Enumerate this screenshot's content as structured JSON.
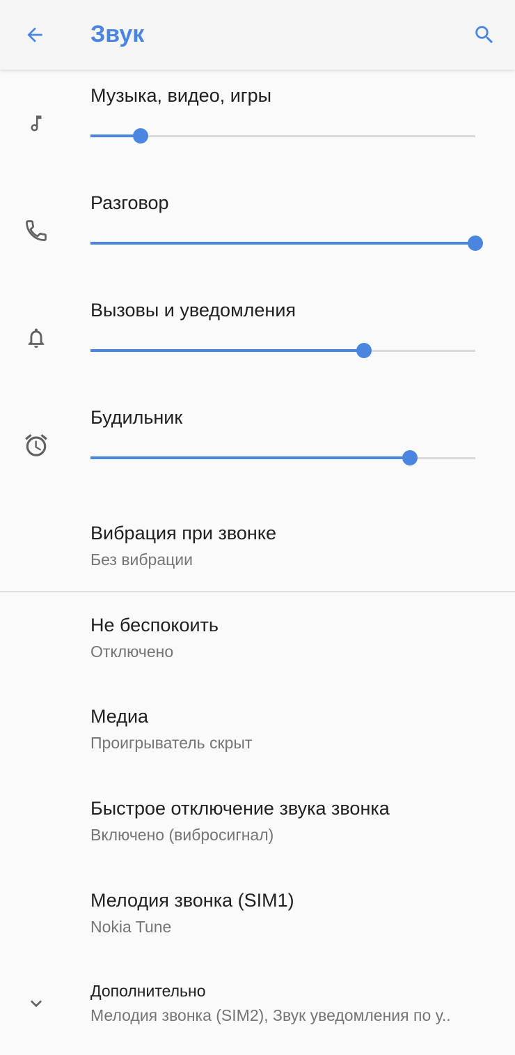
{
  "appbar": {
    "title": "Звук",
    "back_icon": "arrow-back-icon",
    "search_icon": "search-icon",
    "accent": "#4a86e0"
  },
  "volumes": [
    {
      "label": "Музыка, видео, игры",
      "icon": "music-note-icon",
      "level": 0.13
    },
    {
      "label": "Разговор",
      "icon": "phone-icon",
      "level": 1.0
    },
    {
      "label": "Вызовы и уведомления",
      "icon": "bell-icon",
      "level": 0.71
    },
    {
      "label": "Будильник",
      "icon": "alarm-clock-icon",
      "level": 0.83
    }
  ],
  "settings": {
    "vibration": {
      "title": "Вибрация при звонке",
      "summary": "Без вибрации"
    },
    "dnd": {
      "title": "Не беспокоить",
      "summary": "Отключено"
    },
    "media": {
      "title": "Медиа",
      "summary": "Проигрыватель скрыт"
    },
    "quick_mute": {
      "title": "Быстрое отключение звука звонка",
      "summary": "Включено (вибросигнал)"
    },
    "ringtone": {
      "title": "Мелодия звонка (SIM1)",
      "summary": "Nokia Tune"
    },
    "advanced": {
      "title": "Дополнительно",
      "summary": "Мелодия звонка (SIM2), Звук уведомления по у..",
      "icon": "chevron-down-icon"
    }
  }
}
